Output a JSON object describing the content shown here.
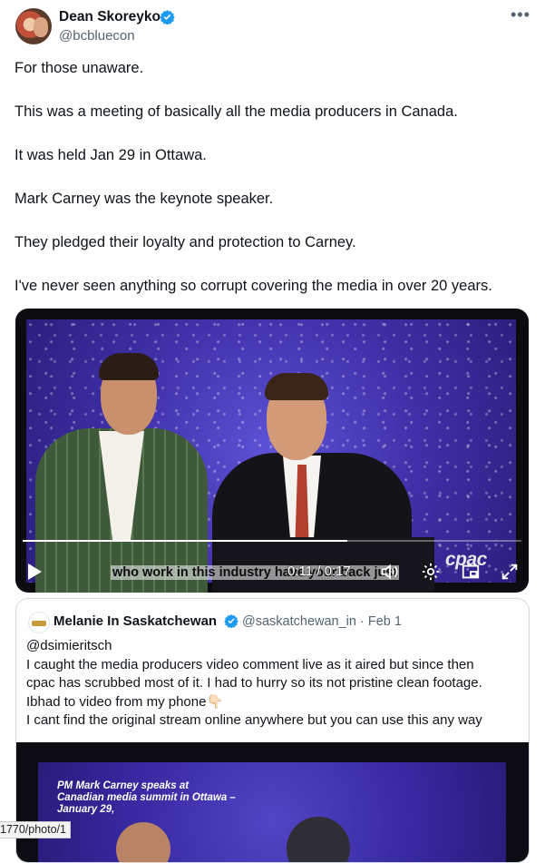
{
  "author": {
    "display_name": "Dean Skoreyko",
    "handle": "@bcbluecon",
    "more_label": "•••"
  },
  "post_lines": [
    "For those unaware.",
    "This was a meeting of basically all the media producers in Canada.",
    "It was held Jan 29 in Ottawa.",
    "Mark Carney was the keynote speaker.",
    "They pledged their loyalty and protection to Carney.",
    "I've never seen anything so corrupt covering the media in over 20 years."
  ],
  "video": {
    "caption": "who work in this industry have your back just",
    "time": "0:11 / 0:17",
    "watermark": "cpac",
    "progress": 0.65,
    "icons": [
      "play-icon",
      "volume-icon",
      "settings-icon",
      "miniplayer-icon",
      "fullscreen-icon"
    ]
  },
  "quoted_post": {
    "display_name": "Melanie In Saskatchewan",
    "handle_date": "@saskatchewan_in · Feb 1",
    "lines": [
      "@dsimieritsch",
      "I caught the media producers video comment live as it aired but since then",
      "cpac has scrubbed most of it. I had to hurry so its not pristine clean footage.",
      "Ibhad to video from my phone👇🏻",
      "I cant find the original stream online anywhere but you can use this any way"
    ],
    "video_banner": "PM Mark Carney speaks at Canadian media summit in Ottawa – January 29,"
  },
  "status_url": "1770/photo/1",
  "colors": {
    "verified_blue": "#1d9bf0",
    "text_primary": "#0f1419",
    "text_secondary": "#536471"
  }
}
